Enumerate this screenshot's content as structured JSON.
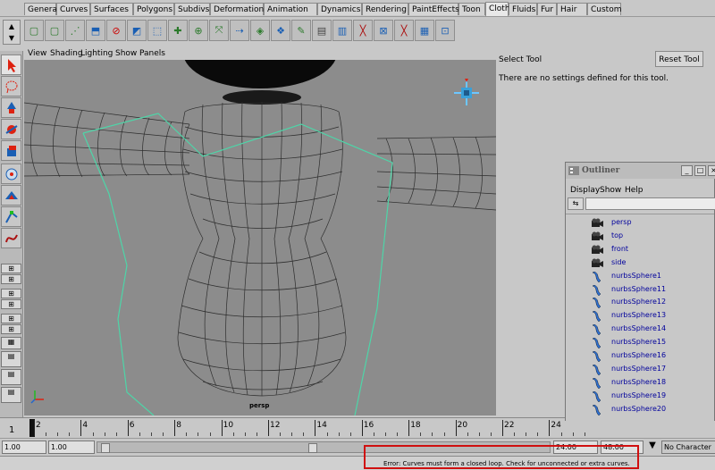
{
  "shelf_tabs": [
    "General",
    "Curves",
    "Surfaces",
    "Polygons",
    "Subdivs",
    "Deformation",
    "Animation",
    "Dynamics",
    "Rendering",
    "PaintEffects",
    "Toon",
    "Cloth",
    "Fluids",
    "Fur",
    "Hair",
    "Custom"
  ],
  "active_tab": "Cloth",
  "panel_menu": [
    "View",
    "Shading",
    "Lighting",
    "Show",
    "Panels"
  ],
  "viewport": {
    "camera_label": "persp"
  },
  "tool_settings": {
    "title": "Select Tool",
    "reset_label": "Reset Tool",
    "info": "There are no settings defined for this tool."
  },
  "outliner": {
    "title": "Outliner",
    "menu": [
      "Display",
      "Show",
      "Help"
    ],
    "items": [
      {
        "label": "persp",
        "icon": "camera-icon"
      },
      {
        "label": "top",
        "icon": "camera-icon"
      },
      {
        "label": "front",
        "icon": "camera-icon"
      },
      {
        "label": "side",
        "icon": "camera-icon"
      },
      {
        "label": "nurbsSphere1",
        "icon": "nurbs-surface-icon"
      },
      {
        "label": "nurbsSphere11",
        "icon": "nurbs-surface-icon"
      },
      {
        "label": "nurbsSphere12",
        "icon": "nurbs-surface-icon"
      },
      {
        "label": "nurbsSphere13",
        "icon": "nurbs-surface-icon"
      },
      {
        "label": "nurbsSphere14",
        "icon": "nurbs-surface-icon"
      },
      {
        "label": "nurbsSphere15",
        "icon": "nurbs-surface-icon"
      },
      {
        "label": "nurbsSphere16",
        "icon": "nurbs-surface-icon"
      },
      {
        "label": "nurbsSphere17",
        "icon": "nurbs-surface-icon"
      },
      {
        "label": "nurbsSphere18",
        "icon": "nurbs-surface-icon"
      },
      {
        "label": "nurbsSphere19",
        "icon": "nurbs-surface-icon"
      },
      {
        "label": "nurbsSphere20",
        "icon": "nurbs-surface-icon"
      }
    ]
  },
  "timeline": {
    "ticks": [
      "2",
      "4",
      "6",
      "8",
      "10",
      "12",
      "14",
      "16",
      "18",
      "20",
      "22",
      "24"
    ],
    "current_frame": "1"
  },
  "range_slider": {
    "start_time": "1.00",
    "playback_start": "1.00",
    "playback_end": "24.00",
    "end_time": "48.00",
    "character_set": "No Character Se"
  },
  "status": {
    "error": "Error: Curves must form a closed loop.  Check for unconnected or extra curves."
  },
  "colors": {
    "curve": "#4ed5a8",
    "wire": "#2e2e2e",
    "error_border": "#d01010",
    "outliner_text": "#00009c"
  }
}
